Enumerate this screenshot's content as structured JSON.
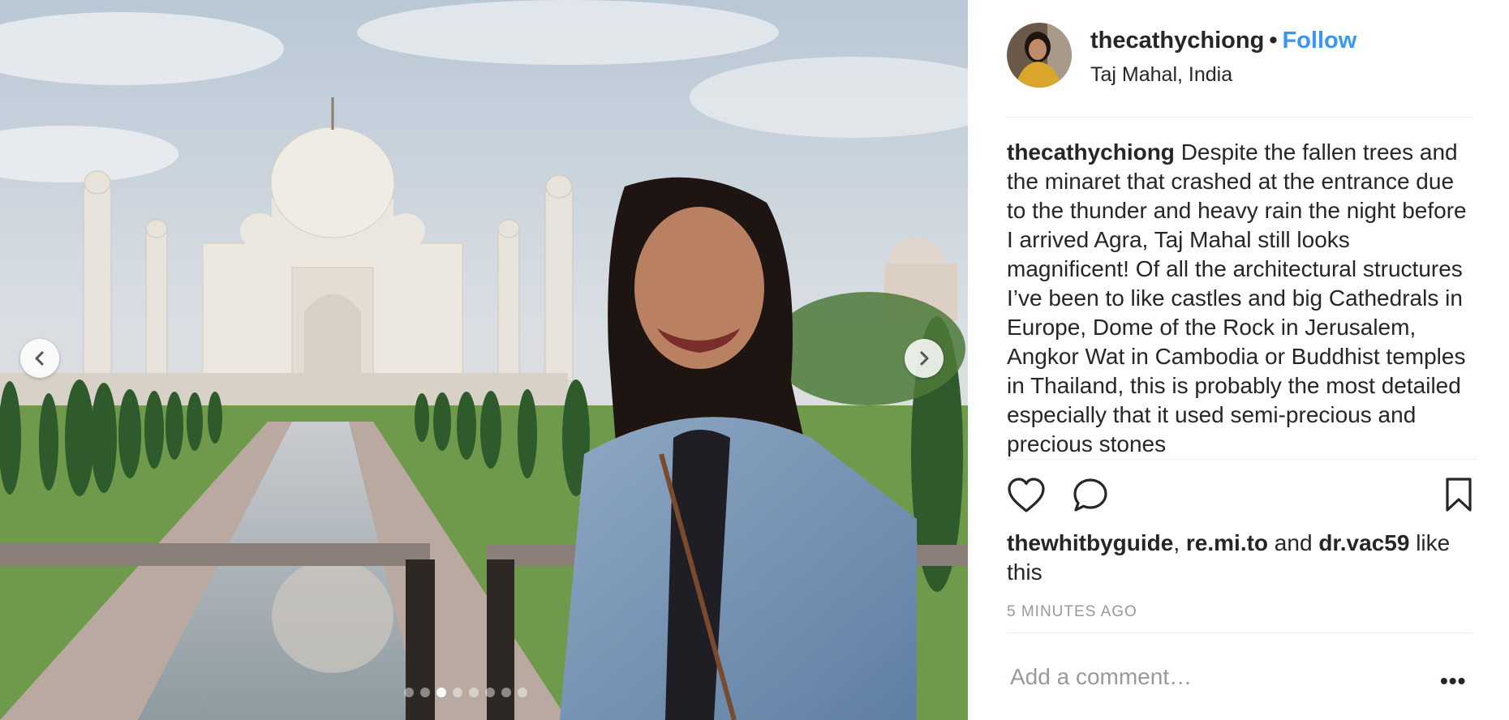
{
  "post": {
    "username": "thecathychiong",
    "separator": "•",
    "follow_label": "Follow",
    "location": "Taj Mahal, India",
    "caption_username": "thecathychiong",
    "caption_text": "Despite the fallen trees and the minaret that crashed at the entrance due to the thunder and heavy rain the night before I arrived Agra, Taj Mahal still looks magnificent! Of all the architectural structures I’ve been to like castles and big Cathedrals in Europe, Dome of the Rock in Jerusalem, Angkor Wat in Cambodia or Buddhist temples in Thailand, this is probably the most detailed especially that it used semi-precious and precious stones",
    "likes": {
      "user1": "thewhitbyguide",
      "comma": ", ",
      "user2": "re.mi.to",
      "and": " and ",
      "user3": "dr.vac59",
      "suffix": " like this"
    },
    "timestamp": "5 MINUTES AGO",
    "comment_placeholder": "Add a comment…",
    "more_label": "•••"
  },
  "carousel": {
    "slide_count": 8,
    "active_index": 2
  },
  "icons": {
    "prev": "chevron-left-icon",
    "next": "chevron-right-icon",
    "like": "heart-icon",
    "comment": "speech-bubble-icon",
    "save": "bookmark-icon",
    "more": "ellipsis-icon"
  },
  "colors": {
    "follow": "#3897f0",
    "text": "#262626",
    "muted": "#999999",
    "divider": "#efefef"
  }
}
